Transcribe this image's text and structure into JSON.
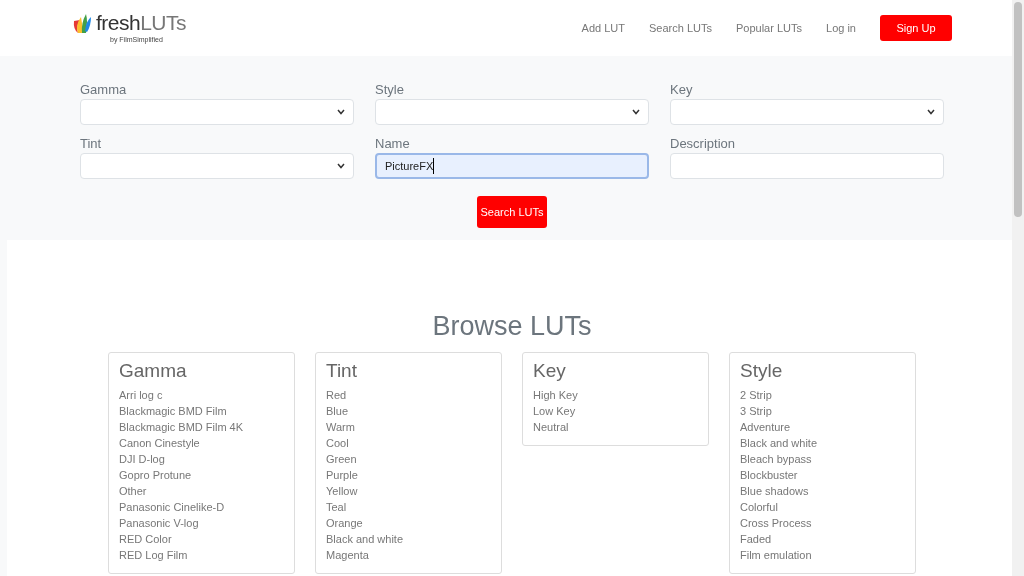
{
  "brand": {
    "name_dark": "fresh",
    "name_light": "LUTs",
    "byline": "by FilmSimplified"
  },
  "nav": [
    {
      "label": "Add LUT",
      "kind": "link"
    },
    {
      "label": "Search LUTs",
      "kind": "link"
    },
    {
      "label": "Popular LUTs",
      "kind": "link"
    },
    {
      "label": "Log in",
      "kind": "link"
    },
    {
      "label": "Sign Up",
      "kind": "button"
    }
  ],
  "search_form": {
    "fields": [
      {
        "label": "Gamma",
        "kind": "select",
        "focused": false
      },
      {
        "label": "Style",
        "kind": "select",
        "focused": false
      },
      {
        "label": "Key",
        "kind": "select",
        "focused": false
      },
      {
        "label": "Tint",
        "kind": "select",
        "focused": false
      },
      {
        "label": "Name",
        "kind": "text",
        "value": "PictureFX",
        "focused": true
      },
      {
        "label": "Description",
        "kind": "text",
        "focused": false
      }
    ],
    "submit": "Search LUTs"
  },
  "browse": {
    "title": "Browse LUTs",
    "categories": [
      {
        "title": "Gamma",
        "items": [
          "Arri log c",
          "Blackmagic BMD Film",
          "Blackmagic BMD Film 4K",
          "Canon Cinestyle",
          "DJI D-log",
          "Gopro Protune",
          "Other",
          "Panasonic Cinelike-D",
          "Panasonic V-log",
          "RED Color",
          "RED Log Film"
        ]
      },
      {
        "title": "Tint",
        "items": [
          "Red",
          "Blue",
          "Warm",
          "Cool",
          "Green",
          "Purple",
          "Yellow",
          "Teal",
          "Orange",
          "Black and white",
          "Magenta"
        ]
      },
      {
        "title": "Key",
        "items": [
          "High Key",
          "Low Key",
          "Neutral"
        ]
      },
      {
        "title": "Style",
        "items": [
          "2 Strip",
          "3 Strip",
          "Adventure",
          "Black and white",
          "Bleach bypass",
          "Blockbuster",
          "Blue shadows",
          "Colorful",
          "Cross Process",
          "Faded",
          "Film emulation"
        ]
      }
    ]
  }
}
